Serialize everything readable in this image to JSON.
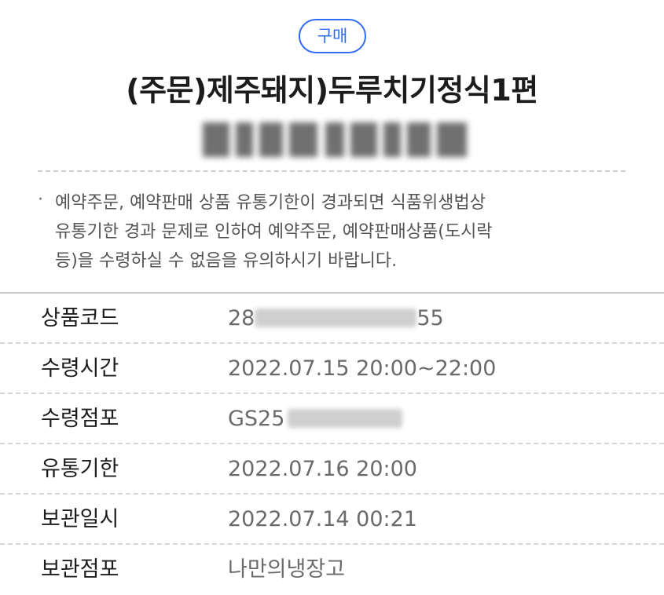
{
  "header": {
    "badge": "구매",
    "title": "(주문)제주돼지)두루치기정식1편"
  },
  "notice": {
    "bullet": "·",
    "text": "예약주문, 예약판매 상품 유통기한이 경과되면 식품위생법상\n유통기한 경과 문제로 인하여 예약주문, 예약판매상품(도시락\n등)을 수령하실 수 없음을 유의하시기 바랍니다."
  },
  "details": {
    "product_code": {
      "label": "상품코드",
      "value_start": "28",
      "value_end": "55"
    },
    "pickup_time": {
      "label": "수령시간",
      "value": "2022.07.15 20:00~22:00"
    },
    "pickup_store": {
      "label": "수령점포",
      "value": "GS25"
    },
    "expiry": {
      "label": "유통기한",
      "value": "2022.07.16 20:00"
    },
    "stored_at": {
      "label": "보관일시",
      "value": "2022.07.14 00:21"
    },
    "storage_store": {
      "label": "보관점포",
      "value": "나만의냉장고"
    }
  },
  "colors": {
    "accent": "#2f6df6",
    "label_text": "#1c1c1c",
    "value_text": "#6a6a6a"
  }
}
